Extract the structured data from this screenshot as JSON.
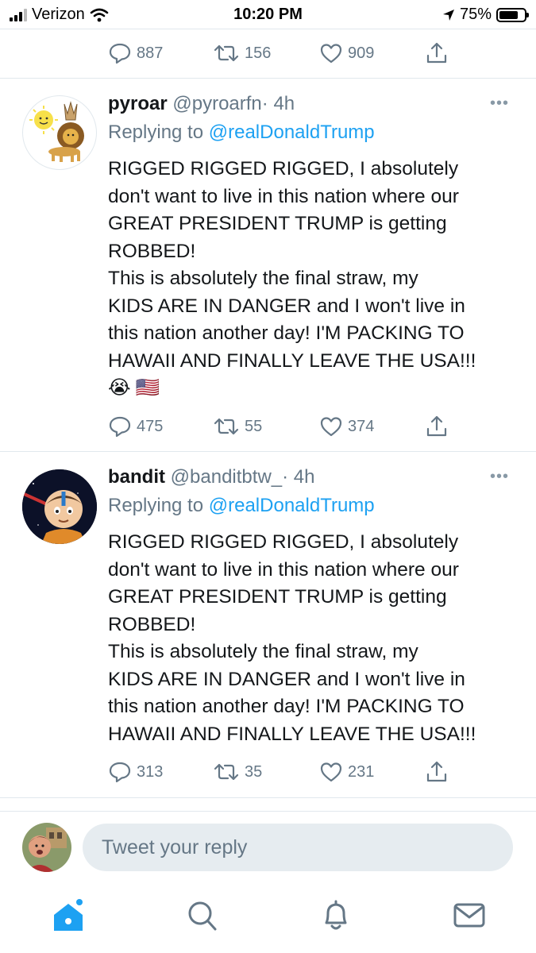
{
  "status_bar": {
    "carrier": "Verizon",
    "time": "10:20 PM",
    "battery": "75%",
    "battery_level": 0.75
  },
  "top_actions": {
    "replies": "887",
    "retweets": "156",
    "likes": "909"
  },
  "tweets": [
    {
      "name": "pyroar",
      "handle": "@pyroarfn",
      "time": "· 4h",
      "replying_prefix": "Replying to",
      "replying_to": "@realDonaldTrump",
      "lines": [
        "RIGGED RIGGED RIGGED, I absolutely",
        "don't want to live in this nation where our",
        "GREAT PRESIDENT TRUMP is getting",
        "ROBBED!",
        "This is absolutely the final straw, my",
        "KIDS ARE IN DANGER and I won't live in",
        "this nation another day! I'M PACKING TO",
        "HAWAII AND FINALLY LEAVE THE USA!!!"
      ],
      "emojis": [
        "😭",
        "🇺🇸"
      ],
      "replies": "475",
      "retweets": "55",
      "likes": "374"
    },
    {
      "name": "bandit",
      "handle": "@banditbtw_",
      "time": "· 4h",
      "replying_prefix": "Replying to",
      "replying_to": "@realDonaldTrump",
      "lines": [
        "RIGGED RIGGED RIGGED, I absolutely",
        "don't want to live in this nation where our",
        "GREAT PRESIDENT TRUMP is getting",
        "ROBBED!",
        "This is absolutely the final straw, my",
        "KIDS ARE IN DANGER and I won't live in",
        "this nation another day! I'M PACKING TO",
        "HAWAII AND FINALLY LEAVE THE USA!!!"
      ],
      "replies": "313",
      "retweets": "35",
      "likes": "231"
    }
  ],
  "reply_box": {
    "placeholder": "Tweet your reply"
  },
  "tab_bar": {
    "items": [
      "home-icon",
      "search-icon",
      "notifications-icon",
      "messages-icon"
    ]
  },
  "colors": {
    "accent": "#1da1f2",
    "muted": "#657786",
    "divider": "#e1e8ed"
  }
}
